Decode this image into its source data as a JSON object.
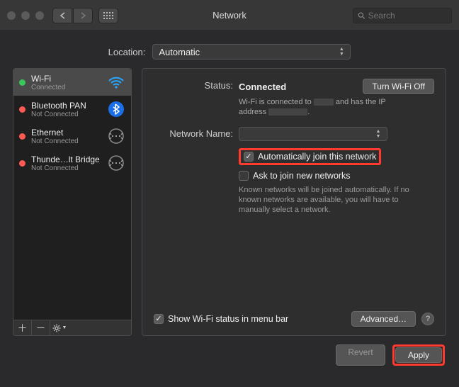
{
  "window": {
    "title": "Network",
    "search_placeholder": "Search"
  },
  "location": {
    "label": "Location:",
    "value": "Automatic"
  },
  "sidebar": {
    "items": [
      {
        "name": "Wi-Fi",
        "status": "Connected",
        "color": "green",
        "icon": "wifi"
      },
      {
        "name": "Bluetooth PAN",
        "status": "Not Connected",
        "color": "red",
        "icon": "bluetooth"
      },
      {
        "name": "Ethernet",
        "status": "Not Connected",
        "color": "red",
        "icon": "ethernet"
      },
      {
        "name": "Thunde…lt Bridge",
        "status": "Not Connected",
        "color": "red",
        "icon": "ethernet"
      }
    ]
  },
  "main": {
    "status_label": "Status:",
    "status_value": "Connected",
    "turn_off_button": "Turn Wi-Fi Off",
    "status_sub_a": "Wi-Fi is connected to",
    "status_sub_b": "and has the IP",
    "status_sub_c": "address",
    "network_name_label": "Network Name:",
    "auto_join_label": "Automatically join this network",
    "ask_join_label": "Ask to join new networks",
    "ask_help": "Known networks will be joined automatically. If no known networks are available, you will have to manually select a network.",
    "show_status_label": "Show Wi-Fi status in menu bar",
    "advanced_button": "Advanced…",
    "help_glyph": "?"
  },
  "footer": {
    "revert": "Revert",
    "apply": "Apply"
  }
}
